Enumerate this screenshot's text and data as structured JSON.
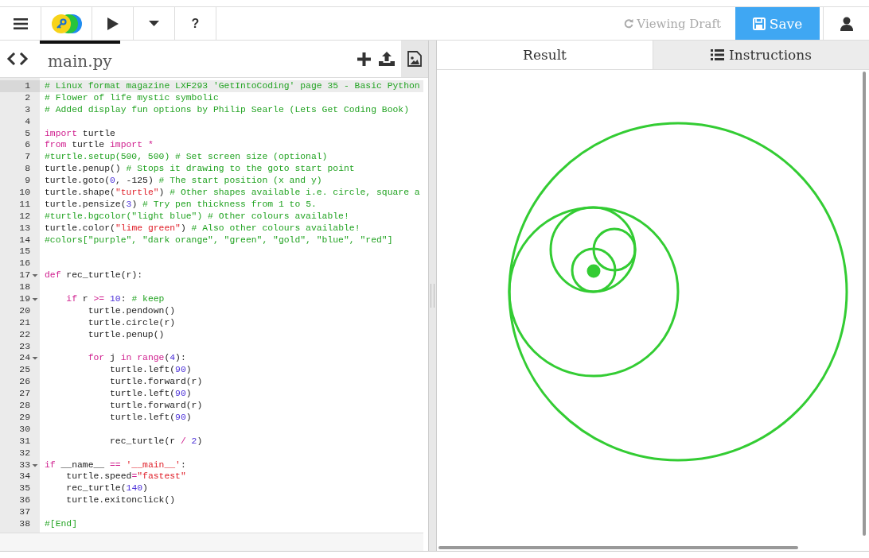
{
  "toolbar": {
    "help": "?",
    "status": "Viewing Draft",
    "save": "Save"
  },
  "editor": {
    "tabs": [
      {
        "label": "main.py",
        "selected": true
      }
    ],
    "lines": [
      {
        "number": "1",
        "active": true,
        "fold": false,
        "tokens": [
          {
            "text": "# Linux format magazine LXF293 'GetIntoCoding' page 35 - Basic Python",
            "kind": "comment"
          }
        ]
      },
      {
        "number": "2",
        "active": false,
        "fold": false,
        "tokens": [
          {
            "text": "# Flower of life mystic symbolic",
            "kind": "comment"
          }
        ]
      },
      {
        "number": "3",
        "active": false,
        "fold": false,
        "tokens": [
          {
            "text": "# Added display fun options by Philip Searle (Lets Get Coding Book)",
            "kind": "comment"
          }
        ]
      },
      {
        "number": "4",
        "active": false,
        "fold": false
      },
      {
        "number": "5",
        "active": false,
        "fold": false,
        "tokens": [
          {
            "text": "import",
            "kind": "keyword"
          },
          {
            "text": " turtle",
            "kind": "plain"
          }
        ]
      },
      {
        "number": "6",
        "active": false,
        "fold": false,
        "tokens": [
          {
            "text": "from",
            "kind": "keyword"
          },
          {
            "text": " turtle ",
            "kind": "plain"
          },
          {
            "text": "import",
            "kind": "keyword"
          },
          {
            "text": " *",
            "kind": "operator"
          }
        ]
      },
      {
        "number": "7",
        "active": false,
        "fold": false,
        "tokens": [
          {
            "text": "#turtle.setup(500, 500) # Set screen size (optional)",
            "kind": "comment"
          }
        ]
      },
      {
        "number": "8",
        "active": false,
        "fold": false,
        "tokens": [
          {
            "text": "turtle.penup() ",
            "kind": "plain"
          },
          {
            "text": "# Stops it drawing to the goto start point",
            "kind": "comment"
          }
        ]
      },
      {
        "number": "9",
        "active": false,
        "fold": false,
        "tokens": [
          {
            "text": "turtle.goto(",
            "kind": "plain"
          },
          {
            "text": "0",
            "kind": "number"
          },
          {
            "text": ", -125) ",
            "kind": "plain"
          },
          {
            "text": "# The start position (x and y)",
            "kind": "comment"
          }
        ]
      },
      {
        "number": "10",
        "active": false,
        "fold": false,
        "tokens": [
          {
            "text": "turtle.shape(",
            "kind": "plain"
          },
          {
            "text": "\"turtle\"",
            "kind": "string"
          },
          {
            "text": ") ",
            "kind": "plain"
          },
          {
            "text": "# Other shapes available i.e. circle, square a",
            "kind": "comment"
          }
        ]
      },
      {
        "number": "11",
        "active": false,
        "fold": false,
        "tokens": [
          {
            "text": "turtle.pensize(",
            "kind": "plain"
          },
          {
            "text": "3",
            "kind": "number"
          },
          {
            "text": ") ",
            "kind": "plain"
          },
          {
            "text": "# Try pen thickness from 1 to 5.",
            "kind": "comment"
          }
        ]
      },
      {
        "number": "12",
        "active": false,
        "fold": false,
        "tokens": [
          {
            "text": "#turtle.bgcolor(\"light blue\") # Other colours available!",
            "kind": "comment"
          }
        ]
      },
      {
        "number": "13",
        "active": false,
        "fold": false,
        "tokens": [
          {
            "text": "turtle.color(",
            "kind": "plain"
          },
          {
            "text": "\"lime green\"",
            "kind": "string"
          },
          {
            "text": ") ",
            "kind": "plain"
          },
          {
            "text": "# Also other colours available!",
            "kind": "comment"
          }
        ]
      },
      {
        "number": "14",
        "active": false,
        "fold": false,
        "tokens": [
          {
            "text": "#colors[\"purple\", \"dark orange\", \"green\", \"gold\", \"blue\", \"red\"]",
            "kind": "comment"
          }
        ]
      },
      {
        "number": "15",
        "active": false,
        "fold": false
      },
      {
        "number": "16",
        "active": false,
        "fold": false
      },
      {
        "number": "17",
        "active": false,
        "fold": true,
        "tokens": [
          {
            "text": "def",
            "kind": "keyword"
          },
          {
            "text": " rec_turtle(r):",
            "kind": "plain"
          }
        ]
      },
      {
        "number": "18",
        "active": false,
        "fold": false
      },
      {
        "number": "19",
        "active": false,
        "fold": true,
        "tokens": [
          {
            "text": "    if",
            "kind": "keyword"
          },
          {
            "text": " r ",
            "kind": "plain"
          },
          {
            "text": ">=",
            "kind": "operator"
          },
          {
            "text": " 10",
            "kind": "number"
          },
          {
            "text": ": ",
            "kind": "plain"
          },
          {
            "text": "# keep",
            "kind": "comment"
          }
        ]
      },
      {
        "number": "20",
        "active": false,
        "fold": false,
        "tokens": [
          {
            "text": "        turtle.pendown()",
            "kind": "plain"
          }
        ]
      },
      {
        "number": "21",
        "active": false,
        "fold": false,
        "tokens": [
          {
            "text": "        turtle.circle(r)",
            "kind": "plain"
          }
        ]
      },
      {
        "number": "22",
        "active": false,
        "fold": false,
        "tokens": [
          {
            "text": "        turtle.penup()",
            "kind": "plain"
          }
        ]
      },
      {
        "number": "23",
        "active": false,
        "fold": false
      },
      {
        "number": "24",
        "active": false,
        "fold": true,
        "tokens": [
          {
            "text": "        for",
            "kind": "keyword"
          },
          {
            "text": " j ",
            "kind": "plain"
          },
          {
            "text": "in",
            "kind": "keyword"
          },
          {
            "text": " range",
            "kind": "keyword"
          },
          {
            "text": "(",
            "kind": "plain"
          },
          {
            "text": "4",
            "kind": "number"
          },
          {
            "text": "):",
            "kind": "plain"
          }
        ]
      },
      {
        "number": "25",
        "active": false,
        "fold": false,
        "tokens": [
          {
            "text": "            turtle.left(",
            "kind": "plain"
          },
          {
            "text": "90",
            "kind": "number"
          },
          {
            "text": ")",
            "kind": "plain"
          }
        ]
      },
      {
        "number": "26",
        "active": false,
        "fold": false,
        "tokens": [
          {
            "text": "            turtle.forward(r)",
            "kind": "plain"
          }
        ]
      },
      {
        "number": "27",
        "active": false,
        "fold": false,
        "tokens": [
          {
            "text": "            turtle.left(",
            "kind": "plain"
          },
          {
            "text": "90",
            "kind": "number"
          },
          {
            "text": ")",
            "kind": "plain"
          }
        ]
      },
      {
        "number": "28",
        "active": false,
        "fold": false,
        "tokens": [
          {
            "text": "            turtle.forward(r)",
            "kind": "plain"
          }
        ]
      },
      {
        "number": "29",
        "active": false,
        "fold": false,
        "tokens": [
          {
            "text": "            turtle.left(",
            "kind": "plain"
          },
          {
            "text": "90",
            "kind": "number"
          },
          {
            "text": ")",
            "kind": "plain"
          }
        ]
      },
      {
        "number": "30",
        "active": false,
        "fold": false
      },
      {
        "number": "31",
        "active": false,
        "fold": false,
        "tokens": [
          {
            "text": "            rec_turtle(r ",
            "kind": "plain"
          },
          {
            "text": "/",
            "kind": "operator"
          },
          {
            "text": " 2",
            "kind": "number"
          },
          {
            "text": ")",
            "kind": "plain"
          }
        ]
      },
      {
        "number": "32",
        "active": false,
        "fold": false
      },
      {
        "number": "33",
        "active": false,
        "fold": true,
        "tokens": [
          {
            "text": "if",
            "kind": "keyword"
          },
          {
            "text": " __name__ ",
            "kind": "plain"
          },
          {
            "text": "==",
            "kind": "operator"
          },
          {
            "text": " '__main__'",
            "kind": "string"
          },
          {
            "text": ":",
            "kind": "plain"
          }
        ]
      },
      {
        "number": "34",
        "active": false,
        "fold": false,
        "tokens": [
          {
            "text": "    turtle.speed",
            "kind": "plain"
          },
          {
            "text": "=",
            "kind": "operator"
          },
          {
            "text": "\"fastest\"",
            "kind": "string"
          }
        ]
      },
      {
        "number": "35",
        "active": false,
        "fold": false,
        "tokens": [
          {
            "text": "    rec_turtle(",
            "kind": "plain"
          },
          {
            "text": "140",
            "kind": "number"
          },
          {
            "text": ")",
            "kind": "plain"
          }
        ]
      },
      {
        "number": "36",
        "active": false,
        "fold": false,
        "tokens": [
          {
            "text": "    turtle.exitonclick()",
            "kind": "plain"
          }
        ]
      },
      {
        "number": "37",
        "active": false,
        "fold": false
      },
      {
        "number": "38",
        "active": false,
        "fold": false,
        "tokens": [
          {
            "text": "#[End]",
            "kind": "comment"
          }
        ]
      }
    ]
  },
  "output": {
    "tabs": [
      {
        "label": "Result",
        "kind": "result",
        "selected": true
      },
      {
        "label": "Instructions",
        "kind": "instructions",
        "selected": false
      }
    ]
  }
}
